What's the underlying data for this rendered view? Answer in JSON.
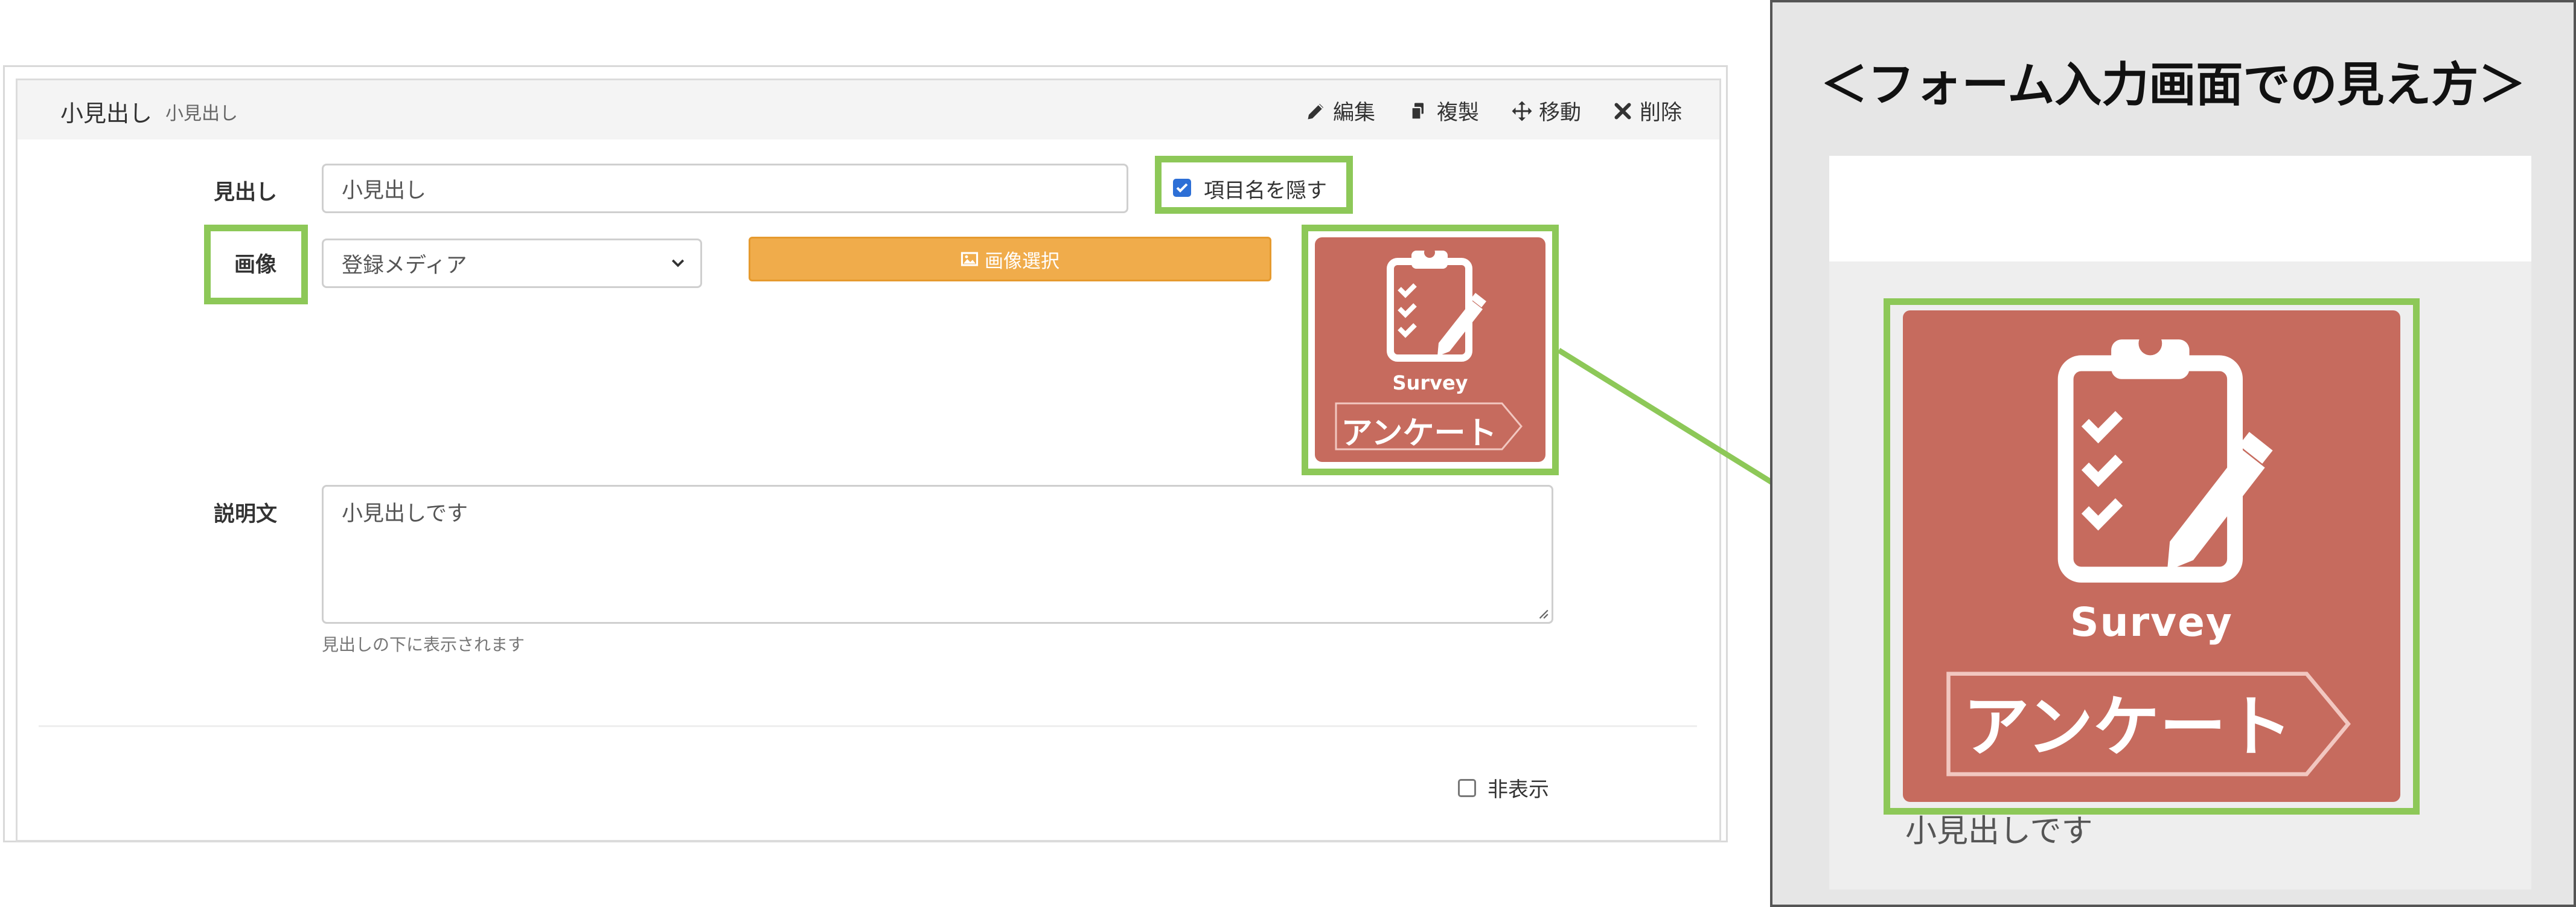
{
  "block": {
    "title": "小見出し",
    "subtitle": "小見出し",
    "actions": [
      {
        "icon": "pencil-icon",
        "label": "編集"
      },
      {
        "icon": "copy-icon",
        "label": "複製"
      },
      {
        "icon": "move-icon",
        "label": "移動"
      },
      {
        "icon": "close-icon",
        "label": "削除"
      }
    ]
  },
  "form": {
    "heading_label": "見出し",
    "heading_value": "小見出し",
    "hide_name_label": "項目名を隠す",
    "hide_name_checked": true,
    "image_label": "画像",
    "image_source_selected": "登録メディア",
    "select_image_button": "画像選択",
    "description_label": "説明文",
    "description_value": "小見出しです",
    "description_help": "見出しの下に表示されます",
    "hidden_label": "非表示",
    "hidden_checked": false
  },
  "image": {
    "caption": "Survey",
    "banner": "アンケート",
    "background_color": "#c66b5e"
  },
  "preview": {
    "title": "＜フォーム入力画面での見え方＞",
    "description_text": "小見出しです"
  },
  "colors": {
    "highlight": "#8dc858",
    "accent_orange": "#f0ac4b",
    "checkbox_blue": "#2d6fd6"
  }
}
